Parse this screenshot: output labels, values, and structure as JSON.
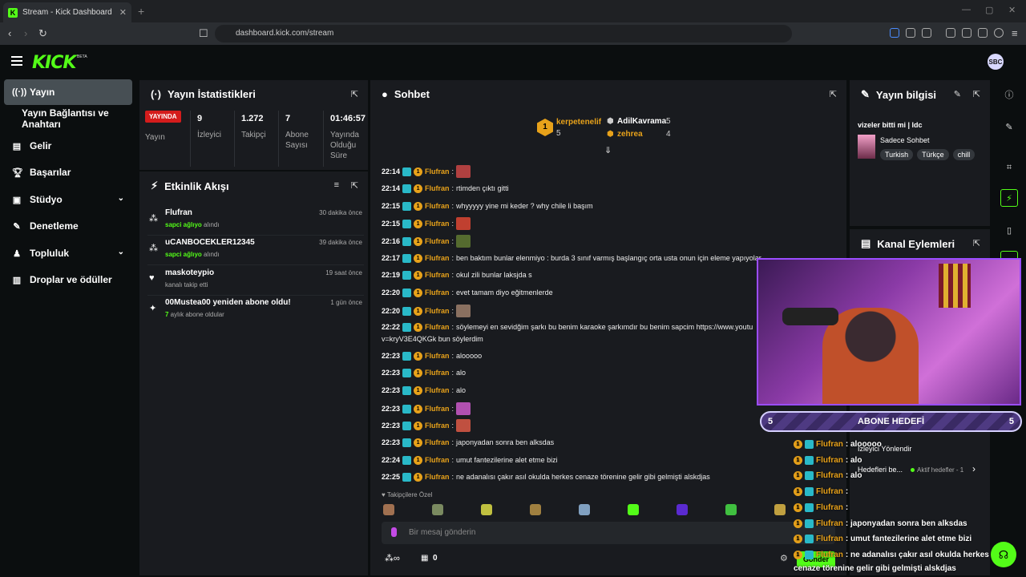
{
  "browser": {
    "tab_title": "Stream - Kick Dashboard",
    "url": "dashboard.kick.com/stream"
  },
  "header": {
    "logo": "KICK",
    "beta": "BETA",
    "avatar": "SBC"
  },
  "sidebar": {
    "items": [
      {
        "label": "Yayın",
        "icon": "broadcast-icon"
      },
      {
        "label": "Yayın Bağlantısı ve Anahtarı",
        "icon": ""
      },
      {
        "label": "Gelir",
        "icon": "revenue-icon"
      },
      {
        "label": "Başarılar",
        "icon": "trophy-icon"
      },
      {
        "label": "Stüdyo",
        "icon": "studio-icon"
      },
      {
        "label": "Denetleme",
        "icon": "wrench-icon"
      },
      {
        "label": "Topluluk",
        "icon": "community-icon"
      },
      {
        "label": "Droplar ve ödüller",
        "icon": "drops-icon"
      }
    ]
  },
  "stats": {
    "title": "Yayın İstatistikleri",
    "live_badge": "YAYINDA",
    "cells": [
      {
        "value": "",
        "label": "Yayın"
      },
      {
        "value": "9",
        "label": "İzleyici"
      },
      {
        "value": "1.272",
        "label": "Takipçi"
      },
      {
        "value": "7",
        "label": "Abone Sayısı"
      },
      {
        "value": "01:46:57",
        "label": "Yayında Olduğu Süre"
      }
    ]
  },
  "activity": {
    "title": "Etkinlik Akışı",
    "items": [
      {
        "name": "Flufran",
        "sub_bold": "sapci ağlıyo",
        "sub_rest": " alındı",
        "time": "30 dakika önce"
      },
      {
        "name": "uCANBOCEKLER12345",
        "sub_bold": "sapci ağlıyo",
        "sub_rest": " alındı",
        "time": "39 dakika önce"
      },
      {
        "name": "maskoteypio",
        "sub_bold": "",
        "sub_rest": "kanalı takip etti",
        "time": "19 saat önce"
      },
      {
        "name": "00Mustea00 yeniden abone oldu!",
        "sub_bold": "7",
        "sub_rest": " aylık abone oldular",
        "time": "1 gün önce"
      }
    ]
  },
  "chat": {
    "title": "Sohbet",
    "leaders": {
      "first": "kerpetenelif",
      "first_count": "5",
      "second": "AdilKavrama",
      "second_count": "5",
      "third": "zehrea",
      "third_count": "4"
    },
    "messages": [
      {
        "time": "22:14",
        "user": "Flufran",
        "text": ""
      },
      {
        "time": "22:14",
        "user": "Flufran",
        "text": "rtimden çıktı gitti"
      },
      {
        "time": "22:15",
        "user": "Flufran",
        "text": "whyyyyy yine mi keder ? why chile li başım"
      },
      {
        "time": "22:15",
        "user": "Flufran",
        "text": ""
      },
      {
        "time": "22:16",
        "user": "Flufran",
        "text": ""
      },
      {
        "time": "22:17",
        "user": "Flufran",
        "text": "ben baktım bunlar elenmiyo : burda 3 sınıf varmış başlangıç orta usta onun için eleme yapıyolar"
      },
      {
        "time": "22:19",
        "user": "Flufran",
        "text": "okul zili bunlar laksjda s"
      },
      {
        "time": "22:20",
        "user": "Flufran",
        "text": "evet tamam diyo eğitmenlerde"
      },
      {
        "time": "22:20",
        "user": "Flufran",
        "text": ""
      },
      {
        "time": "22:22",
        "user": "Flufran",
        "text": "söylemeyi en sevidğim şarkı bu benim karaoke şarkımdır bu benim sapcim https://www.youtu"
      },
      {
        "time": "",
        "user": "",
        "text": "v=kryV3E4QKGk bun söylerdim"
      },
      {
        "time": "22:23",
        "user": "Flufran",
        "text": "alooooo"
      },
      {
        "time": "22:23",
        "user": "Flufran",
        "text": "alo"
      },
      {
        "time": "22:23",
        "user": "Flufran",
        "text": "alo"
      },
      {
        "time": "22:23",
        "user": "Flufran",
        "text": ""
      },
      {
        "time": "22:23",
        "user": "Flufran",
        "text": ""
      },
      {
        "time": "22:23",
        "user": "Flufran",
        "text": "japonyadan sonra ben alksdas"
      },
      {
        "time": "22:24",
        "user": "Flufran",
        "text": "umut fantezilerine alet etme bizi"
      },
      {
        "time": "22:25",
        "user": "Flufran",
        "text": "ne adanalısı çakır asıl okulda herkes cenaze törenine gelir gibi gelmişti alskdjas"
      }
    ],
    "followers_only": "Takipçilere Özel",
    "input_placeholder": "Bir mesaj gönderin",
    "points": "0",
    "send": "Gönder"
  },
  "info": {
    "title": "Yayın bilgisi",
    "stream_title": "vizeler bitti mi | ldc",
    "category": "Sadece Sohbet",
    "tags": [
      "Turkish",
      "Türkçe",
      "chill"
    ]
  },
  "channel_actions": {
    "title": "Kanal Eylemleri",
    "viewer_directed": "İzleyici Yönlendir",
    "goals": "Hedefleri be...",
    "active_goals": "Aktif hedefler - 1"
  },
  "overlay": {
    "goal_left": "5",
    "goal_title": "ABONE HEDEFİ",
    "goal_right": "5",
    "lines": [
      {
        "user": "Flufran",
        "text": ": alooooo"
      },
      {
        "user": "Flufran",
        "text": ": alo"
      },
      {
        "user": "Flufran",
        "text": ": alo"
      },
      {
        "user": "Flufran",
        "text": ":"
      },
      {
        "user": "Flufran",
        "text": ":"
      },
      {
        "user": "Flufran",
        "text": ": japonyadan sonra ben alksdas"
      },
      {
        "user": "Flufran",
        "text": ": umut fantezilerine alet etme bizi"
      },
      {
        "user": "Flufran",
        "text": ": ne adanalısı çakır asıl okulda herkes"
      }
    ],
    "wrap": "cenaze törenine gelir gibi gelmişti alskdjas"
  },
  "colors": {
    "accent": "#53fc18",
    "username": "#e8a21a",
    "panel": "#191b1f",
    "live": "#d41c1c"
  }
}
